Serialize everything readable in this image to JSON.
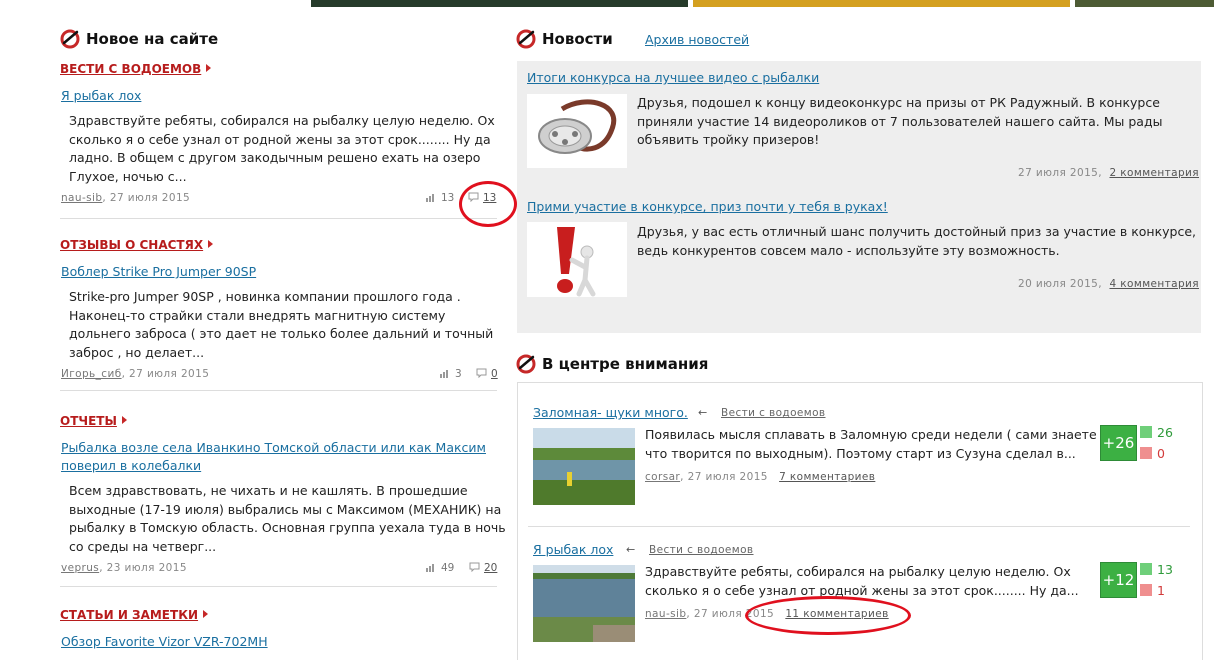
{
  "left": {
    "heading": "Новое на сайте",
    "items": [
      {
        "category": "ВЕСТИ С ВОДОЕМОВ",
        "title": "Я рыбак лох",
        "excerpt": [
          "Здравствуйте ребяты, собирался на рыбалку целую неделю. Ох",
          "сколько я о себе узнал от родной жены за этот срок........ Ну да",
          "ладно. В общем с другом закодычным решено ехать на озеро",
          "Глухое, ночью с..."
        ],
        "author": "nau-sib",
        "date": ", 27 июля 2015",
        "views": "13",
        "comments": "13"
      },
      {
        "category": "ОТЗЫВЫ О СНАСТЯХ",
        "title": "Воблер Strike Pro Jumper 90SP",
        "excerpt": [
          "Strike-pro Jumper 90SP , новинка компании прошлого года .",
          "Наконец-то страйки стали внедрять магнитную систему",
          "дольнего заброса ( это дает не только более дальний и точный",
          "заброс , но делает..."
        ],
        "author": "Игорь_сиб",
        "date": ", 27 июля 2015",
        "views": "3",
        "comments": "0"
      },
      {
        "category": "ОТЧЕТЫ",
        "title_lines": [
          "Рыбалка возле села Иванкино Томской области или как Максим",
          "поверил в колебалки"
        ],
        "excerpt": [
          "Всем здравствовать, не чихать и не кашлять. В прошедшие",
          "выходные (17-19 июля) выбрались мы с Максимом (МЕХАНИК) на",
          "рыбалку в Томскую область. Основная группа уехала туда в ночь",
          "со среды на четверг..."
        ],
        "author": "veprus",
        "date": ", 23 июля 2015",
        "views": "49",
        "comments": "20"
      },
      {
        "category": "СТАТЬИ И ЗАМЕТКИ",
        "title": "Обзор Favorite Vizor VZR-702MH"
      }
    ]
  },
  "news": {
    "heading": "Новости",
    "archive_link": "Архив новостей",
    "items": [
      {
        "title": "Итоги конкурса на лучшее видео с рыбалки",
        "text": [
          "Друзья, подошел к концу видеоконкурс на призы от РК Радужный. В конкурсе",
          "приняли участие 14 видеороликов от 7 пользователей нашего сайта. Мы рады",
          "объявить тройку призеров!"
        ],
        "date": "27 июля 2015,",
        "comments": "2 комментария"
      },
      {
        "title": "Прими участие в конкурсе, приз почти у тебя в руках!",
        "text": [
          "Друзья, у вас есть отличный шанс получить достойный приз за участие в конкурсе,",
          "ведь конкурентов совсем мало - используйте эту возможность."
        ],
        "date": "20 июля 2015,",
        "comments": "4 комментария"
      }
    ]
  },
  "focus": {
    "heading": "В центре внимания",
    "items": [
      {
        "title": "Заломная- щуки много.",
        "arrow": "←",
        "category": "Вести с водоемов",
        "text": [
          "Появилась мысля сплавать в Заломную среди недели ( сами знаете",
          "что творится по выходным). Поэтому старт из Сузуна сделал в..."
        ],
        "author": "corsar",
        "date": ", 27 июля 2015",
        "comments": "7 комментариев",
        "rating": "+26",
        "up": "26",
        "down": "0"
      },
      {
        "title": "Я рыбак лох",
        "arrow": "←",
        "category": "Вести с водоемов",
        "text": [
          "Здравствуйте ребяты, собирался на рыбалку целую неделю. Ох",
          "сколько я о себе узнал от родной жены за этот срок........ Ну да..."
        ],
        "author": "nau-sib",
        "date": ", 27 июля 2015",
        "comments": "11 комментариев",
        "rating": "+12",
        "up": "13",
        "down": "1"
      }
    ]
  },
  "colors": {
    "accent_red": "#b71c1c",
    "link_blue": "#1a6fa0",
    "vote_green": "#3cb043",
    "annotation_red": "#e0101e"
  }
}
